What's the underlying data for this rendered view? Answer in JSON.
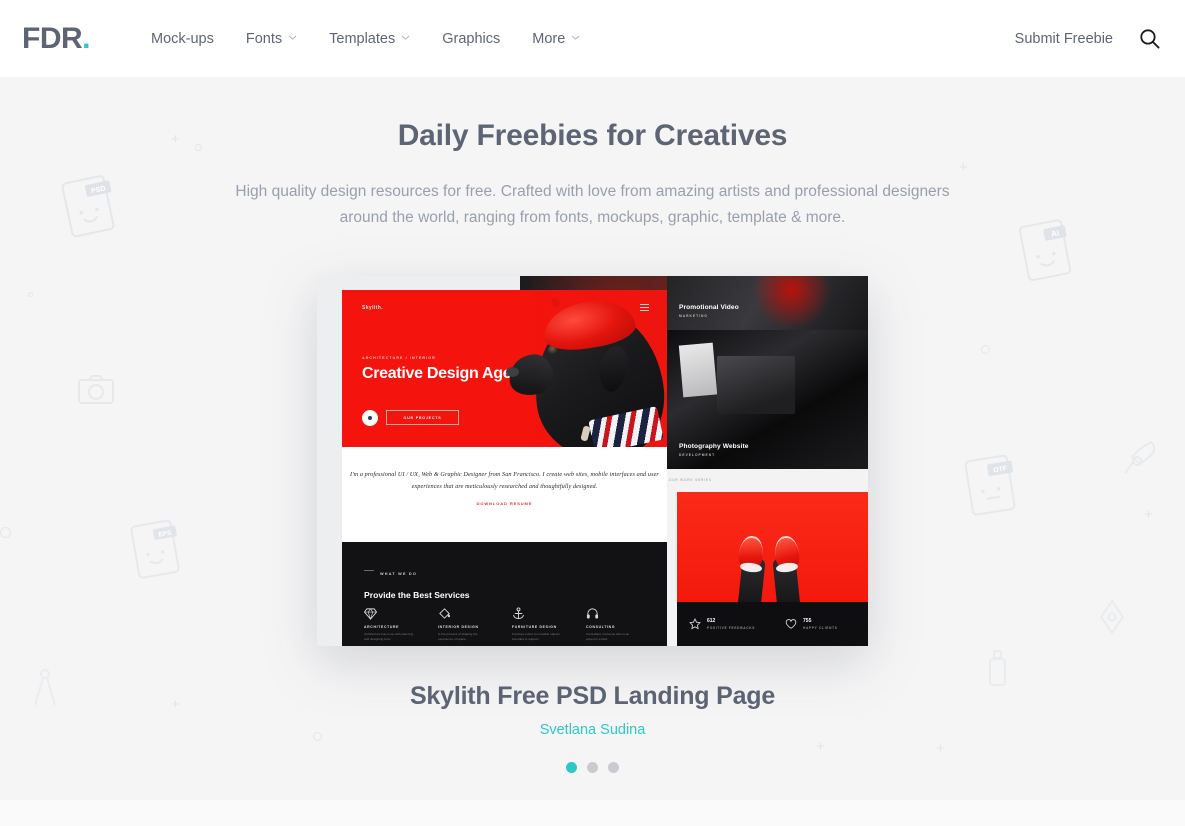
{
  "header": {
    "logo_text": "FDR",
    "logo_dot": ".",
    "nav": [
      {
        "label": "Mock-ups",
        "has_caret": false
      },
      {
        "label": "Fonts",
        "has_caret": true
      },
      {
        "label": "Templates",
        "has_caret": true
      },
      {
        "label": "Graphics",
        "has_caret": false
      },
      {
        "label": "More",
        "has_caret": true
      }
    ],
    "submit_label": "Submit Freebie",
    "search_icon": "search-icon"
  },
  "hero": {
    "title": "Daily Freebies for Creatives",
    "subtitle": "High quality design resources for free. Crafted with love from amazing artists and professional designers around the world, ranging from fonts, mockups, graphic, template & more."
  },
  "showcase": {
    "item_title": "Skylith Free PSD Landing Page",
    "author": "Svetlana Sudina",
    "dots": [
      {
        "active": true
      },
      {
        "active": false
      },
      {
        "active": false
      }
    ],
    "preview": {
      "brand": "Skylith.",
      "eyebrow": "ARCHITECTURE / INTERIOR",
      "headline": "Creative Design Agency",
      "cta_label": "OUR PROJECTS",
      "quote": "I'm a professional UI / UX, Web & Graphic Designer from San Francisco. I create web sites, mobile interfaces and user experiences that are meticulously researched and thoughtfully designed.",
      "quote_link": "DOWNLOAD RESUME",
      "dark_kicker": "WHAT WE DO",
      "dark_headline": "Provide the Best Services",
      "services": [
        {
          "icon": "diamond-icon",
          "name": "ARCHITECTURE",
          "text": "Architecture has to do with planning and designing form."
        },
        {
          "icon": "paint-bucket-icon",
          "name": "INTERIOR DESIGN",
          "text": "Is the process of shaping the experience of space."
        },
        {
          "icon": "anchor-icon",
          "name": "FURNITURE DESIGN",
          "text": "Furniture refers to movable objects intended to support."
        },
        {
          "icon": "headphones-icon",
          "name": "CONSULTING",
          "text": "Consultant, someone who is an expert in a field."
        }
      ],
      "right_cards": [
        {
          "title": "Promotional Video",
          "subtitle": "MARKETING"
        },
        {
          "title": "Photography Website",
          "subtitle": "DEVELOPMENT"
        }
      ],
      "gap_label": "OUR WORK SERIES",
      "stats": [
        {
          "icon": "star-icon",
          "value": "612",
          "label": "POSITIVE FEEDBACKS"
        },
        {
          "icon": "heart-icon",
          "value": "755",
          "label": "HAPPY CLIENTS"
        }
      ]
    }
  },
  "decorations": [
    {
      "name": "file-psd-icon",
      "label": "PSD"
    },
    {
      "name": "file-ai-icon",
      "label": "Ai"
    },
    {
      "name": "file-otf-icon",
      "label": "OTF"
    },
    {
      "name": "file-eps-icon",
      "label": "EPS"
    },
    {
      "name": "camera-icon",
      "label": ""
    },
    {
      "name": "brush-icon",
      "label": ""
    },
    {
      "name": "pen-nib-icon",
      "label": ""
    },
    {
      "name": "compass-icon",
      "label": ""
    },
    {
      "name": "spray-can-icon",
      "label": ""
    }
  ],
  "colors": {
    "accent_teal": "#2ec8c8",
    "text_dark": "#5d6575",
    "text_muted": "#98a0ad",
    "page_bg": "#f5f5f6",
    "header_bg": "#ffffff",
    "preview_red": "#f4130d"
  }
}
